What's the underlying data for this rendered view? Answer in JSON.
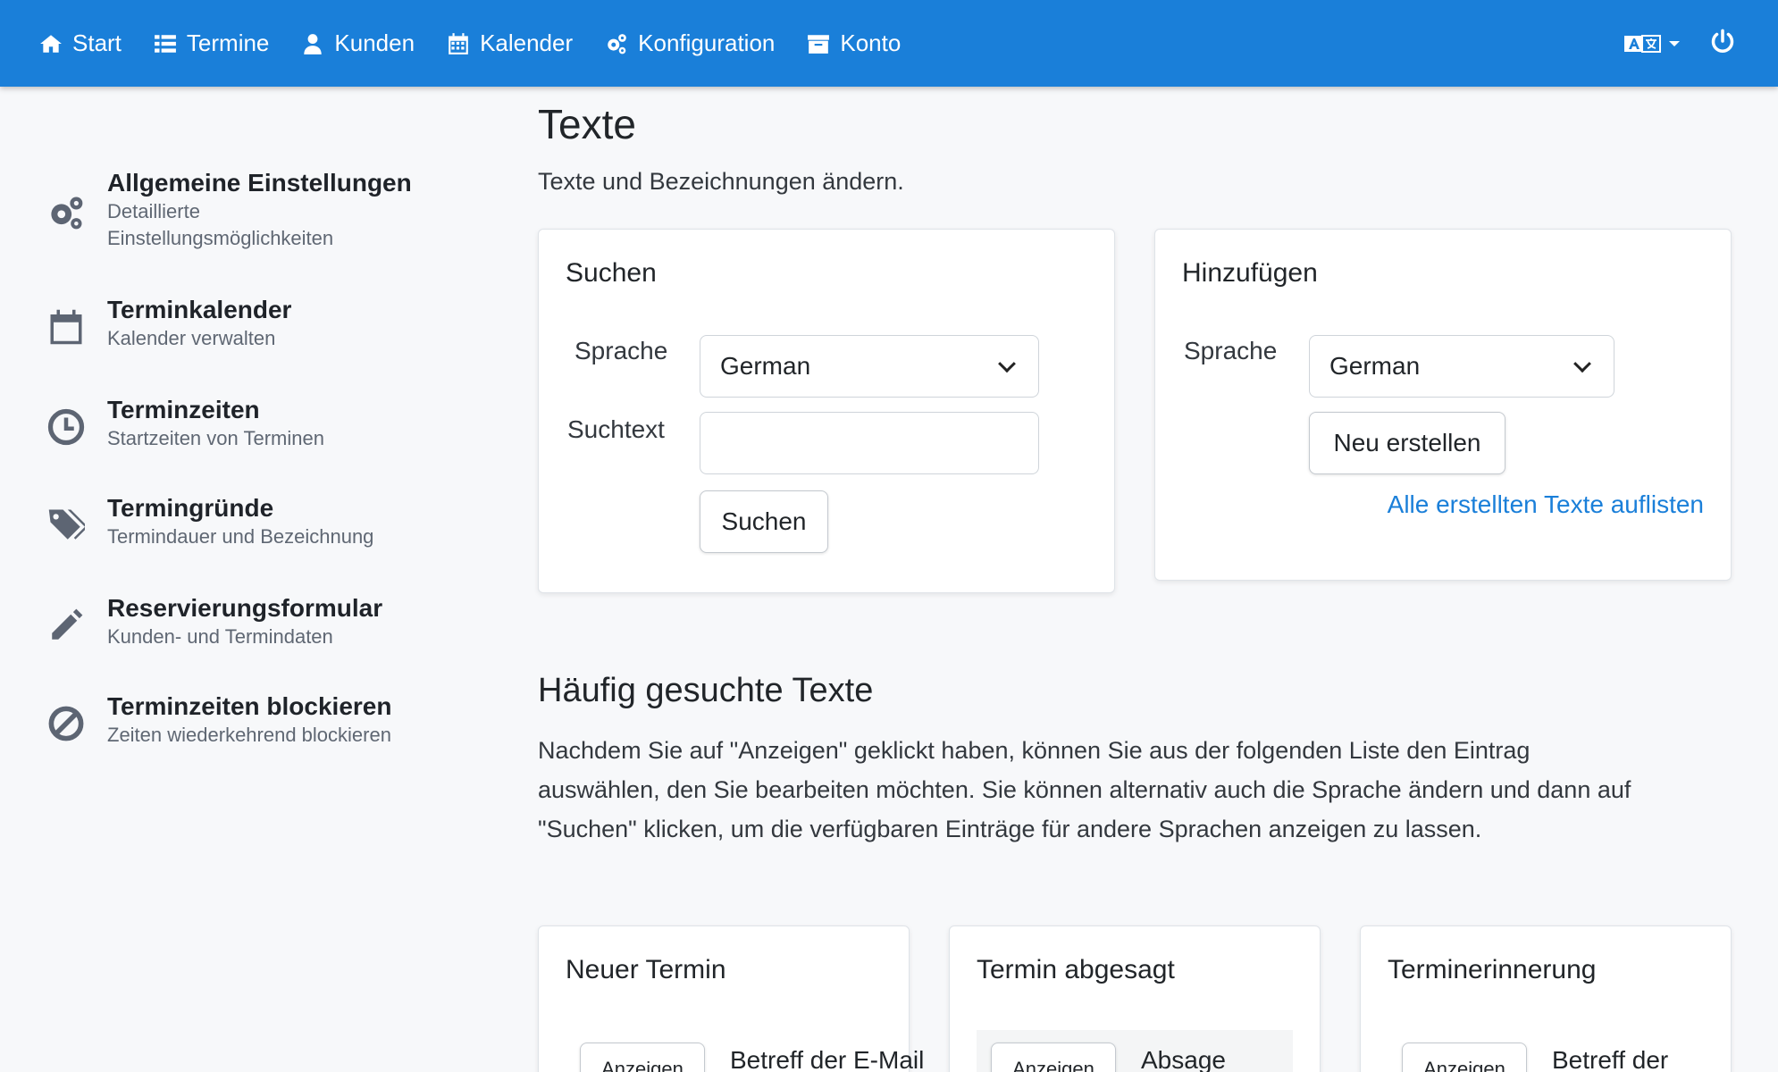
{
  "navbar": {
    "items": [
      {
        "label": "Start",
        "icon": "home-icon"
      },
      {
        "label": "Termine",
        "icon": "list-icon"
      },
      {
        "label": "Kunden",
        "icon": "user-icon"
      },
      {
        "label": "Kalender",
        "icon": "calendar-icon"
      },
      {
        "label": "Konfiguration",
        "icon": "cogs-icon"
      },
      {
        "label": "Konto",
        "icon": "archive-icon"
      }
    ],
    "language_icon": "language-icon",
    "power_icon": "power-icon"
  },
  "sidebar": {
    "items": [
      {
        "title": "Allgemeine Einstellungen",
        "desc1": "Detaillierte",
        "desc2": "Einstellungsmöglichkeiten",
        "icon": "cogs-icon"
      },
      {
        "title": "Terminkalender",
        "desc1": "Kalender verwalten",
        "desc2": "",
        "icon": "calendar-icon"
      },
      {
        "title": "Terminzeiten",
        "desc1": "Startzeiten von Terminen",
        "desc2": "",
        "icon": "clock-icon"
      },
      {
        "title": "Termingründe",
        "desc1": "Termindauer und Bezeichnung",
        "desc2": "",
        "icon": "tags-icon"
      },
      {
        "title": "Reservierungsformular",
        "desc1": "Kunden- und Termindaten",
        "desc2": "",
        "icon": "pencil-icon"
      },
      {
        "title": "Terminzeiten blockieren",
        "desc1": "Zeiten wiederkehrend blockieren",
        "desc2": "",
        "icon": "ban-icon"
      }
    ]
  },
  "main": {
    "title": "Texte",
    "subtitle": "Texte und Bezeichnungen ändern.",
    "search_card": {
      "title": "Suchen",
      "language_label": "Sprache",
      "language_value": "German",
      "searchtext_label": "Suchtext",
      "searchtext_value": "",
      "search_button": "Suchen"
    },
    "add_card": {
      "title": "Hinzufügen",
      "language_label": "Sprache",
      "language_value": "German",
      "create_button": "Neu erstellen",
      "list_link": "Alle erstellten Texte auflisten"
    },
    "frequent": {
      "title": "Häufig gesuchte Texte",
      "line1": "Nachdem Sie auf \"Anzeigen\" geklickt haben, können Sie aus der folgenden Liste den Eintrag",
      "line2": "auswählen, den Sie bearbeiten möchten. Sie können alternativ auch die Sprache ändern und dann auf",
      "line3": "\"Suchen\" klicken, um die verfügbaren Einträge für andere Sprachen anzeigen zu lassen."
    },
    "cards": [
      {
        "title": "Neuer Termin",
        "button": "Anzeigen",
        "row_text": "Betreff der E-Mail"
      },
      {
        "title": "Termin abgesagt",
        "button": "Anzeigen",
        "row_text": "Absage"
      },
      {
        "title": "Terminerinnerung",
        "button": "Anzeigen",
        "row_text": "Betreff der"
      }
    ]
  },
  "colors": {
    "navbar": "#1a7fd9",
    "link": "#1a7fd9",
    "background": "#f7f8fa"
  }
}
